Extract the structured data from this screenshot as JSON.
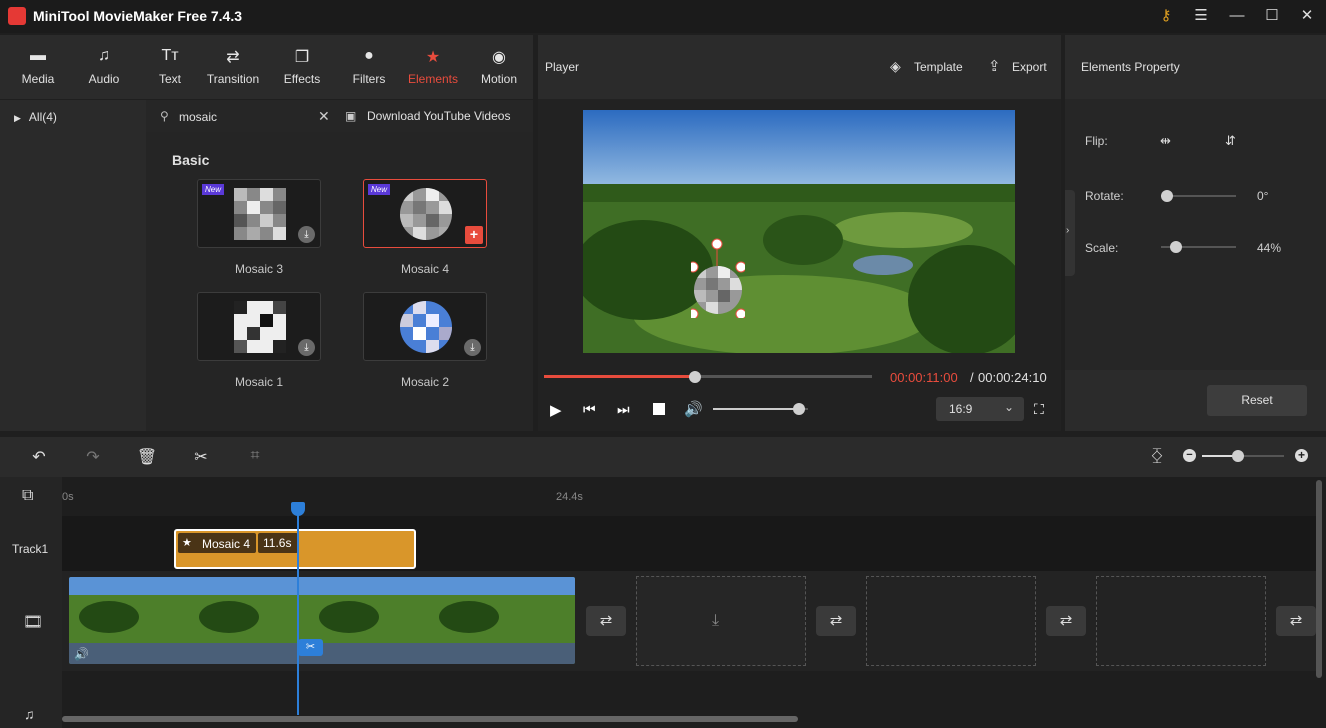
{
  "app": {
    "title": "MiniTool MovieMaker Free 7.4.3"
  },
  "toolbar": {
    "items": [
      {
        "label": "Media",
        "icon": "folder-icon"
      },
      {
        "label": "Audio",
        "icon": "music-note-icon"
      },
      {
        "label": "Text",
        "icon": "text-icon"
      },
      {
        "label": "Transition",
        "icon": "transition-icon"
      },
      {
        "label": "Effects",
        "icon": "effects-icon"
      },
      {
        "label": "Filters",
        "icon": "filters-icon"
      },
      {
        "label": "Elements",
        "icon": "elements-icon",
        "active": true
      },
      {
        "label": "Motion",
        "icon": "motion-icon"
      }
    ]
  },
  "browser": {
    "category": "All(4)",
    "search_value": "mosaic",
    "download_youtube": "Download YouTube Videos",
    "section_title": "Basic",
    "items": [
      {
        "name": "Mosaic 3",
        "new_badge": "New"
      },
      {
        "name": "Mosaic 4",
        "new_badge": "New",
        "selected": true
      },
      {
        "name": "Mosaic 1"
      },
      {
        "name": "Mosaic 2"
      }
    ]
  },
  "player": {
    "title": "Player",
    "template_label": "Template",
    "export_label": "Export",
    "current_time": "00:00:11:00",
    "separator": "/",
    "total_time": "00:00:24:10",
    "progress": 0.46,
    "volume": 0.9,
    "aspect_ratio": "16:9"
  },
  "properties": {
    "title": "Elements Property",
    "flip_label": "Flip:",
    "rotate_label": "Rotate:",
    "rotate_value": "0°",
    "rotate_fraction": 0.0,
    "scale_label": "Scale:",
    "scale_value": "44%",
    "scale_fraction": 0.12,
    "reset_label": "Reset"
  },
  "timeline": {
    "ruler_start": "0s",
    "ruler_mark": "24.4s",
    "track1_label": "Track1",
    "clip_name": "Mosaic 4",
    "clip_duration": "11.6s"
  },
  "colors": {
    "accent": "#e84c3d",
    "clip": "#d9962a",
    "playhead": "#2d7fd9"
  }
}
